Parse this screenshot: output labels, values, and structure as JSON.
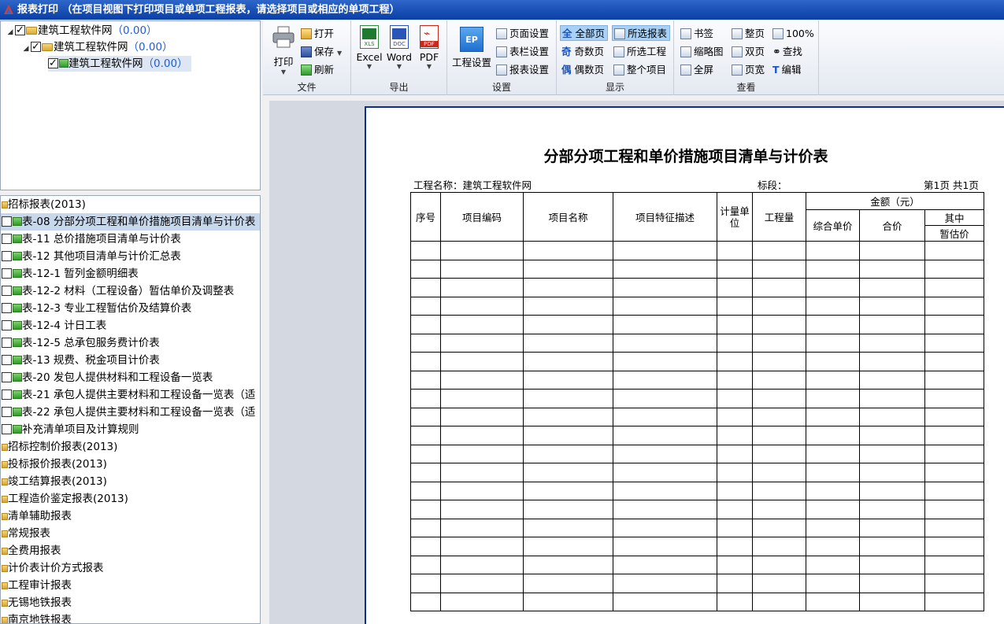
{
  "window": {
    "title": "报表打印 （在项目视图下打印项目或单项工程报表，请选择项目或相应的单项工程）"
  },
  "project_tree": [
    {
      "name": "建筑工程软件网",
      "value": "（0.00）"
    },
    {
      "name": "建筑工程软件网",
      "value": "（0.00）"
    },
    {
      "name": "建筑工程软件网",
      "value": "（0.00）"
    }
  ],
  "report_list": [
    {
      "label": "招标报表(2013)",
      "type": "category"
    },
    {
      "label": "表-08 分部分项工程和单价措施项目清单与计价表",
      "type": "item"
    },
    {
      "label": "表-11 总价措施项目清单与计价表",
      "type": "item"
    },
    {
      "label": "表-12 其他项目清单与计价汇总表",
      "type": "item"
    },
    {
      "label": "表-12-1 暂列金额明细表",
      "type": "item"
    },
    {
      "label": "表-12-2 材料（工程设备）暂估单价及调整表",
      "type": "item"
    },
    {
      "label": "表-12-3 专业工程暂估价及结算价表",
      "type": "item"
    },
    {
      "label": "表-12-4 计日工表",
      "type": "item"
    },
    {
      "label": "表-12-5 总承包服务费计价表",
      "type": "item"
    },
    {
      "label": "表-13 规费、税金项目计价表",
      "type": "item"
    },
    {
      "label": "表-20 发包人提供材料和工程设备一览表",
      "type": "item"
    },
    {
      "label": "表-21 承包人提供主要材料和工程设备一览表（适",
      "type": "item"
    },
    {
      "label": "表-22 承包人提供主要材料和工程设备一览表（适",
      "type": "item"
    },
    {
      "label": "补充清单项目及计算规则",
      "type": "item"
    },
    {
      "label": "招标控制价报表(2013)",
      "type": "category"
    },
    {
      "label": "投标报价报表(2013)",
      "type": "category"
    },
    {
      "label": "竣工结算报表(2013)",
      "type": "category"
    },
    {
      "label": "工程造价鉴定报表(2013)",
      "type": "category"
    },
    {
      "label": "清单辅助报表",
      "type": "category"
    },
    {
      "label": "常规报表",
      "type": "category"
    },
    {
      "label": "全费用报表",
      "type": "category"
    },
    {
      "label": "计价表计价方式报表",
      "type": "category"
    },
    {
      "label": "工程审计报表",
      "type": "category"
    },
    {
      "label": "无锡地铁报表",
      "type": "category"
    },
    {
      "label": "南京地铁报表",
      "type": "category"
    }
  ],
  "ribbon": {
    "file": {
      "label": "文件",
      "print": "打印",
      "open": "打开",
      "save": "保存",
      "refresh": "刷新"
    },
    "export": {
      "label": "导出",
      "excel": "Excel",
      "excel_tag": "XLS",
      "word": "Word",
      "word_tag": "DOC",
      "pdf": "PDF",
      "pdf_tag": "PDF"
    },
    "settings": {
      "label": "设置",
      "project": "工程设置",
      "page": "页面设置",
      "columns": "表栏设置",
      "report": "报表设置"
    },
    "display": {
      "label": "显示",
      "all_pages": "全部页",
      "odd_pages": "奇数页",
      "even_pages": "偶数页",
      "selected_report": "所选报表",
      "selected_project": "所选工程",
      "whole_project": "整个项目",
      "odd_char": "奇",
      "even_char": "偶",
      "all_char": "全"
    },
    "view": {
      "label": "查看",
      "bookmark": "书签",
      "thumbnail": "缩略图",
      "fullscreen": "全屏",
      "whole_page": "整页",
      "double_page": "双页",
      "page_width": "页宽",
      "zoom": "100%",
      "find": "查找",
      "edit": "编辑"
    }
  },
  "report": {
    "title": "分部分项工程和单价措施项目清单与计价表",
    "project_name": "工程名称：建筑工程软件网",
    "section": "标段：",
    "page_info": "第1页  共1页",
    "headers": {
      "seq": "序号",
      "code": "项目编码",
      "name": "项目名称",
      "desc": "项目特征描述",
      "unit": "计量单位",
      "qty": "工程量",
      "amount": "金额（元）",
      "unit_price": "综合单价",
      "total": "合价",
      "of_which": "其中",
      "provisional": "暂估价"
    },
    "empty_rows": 20
  }
}
